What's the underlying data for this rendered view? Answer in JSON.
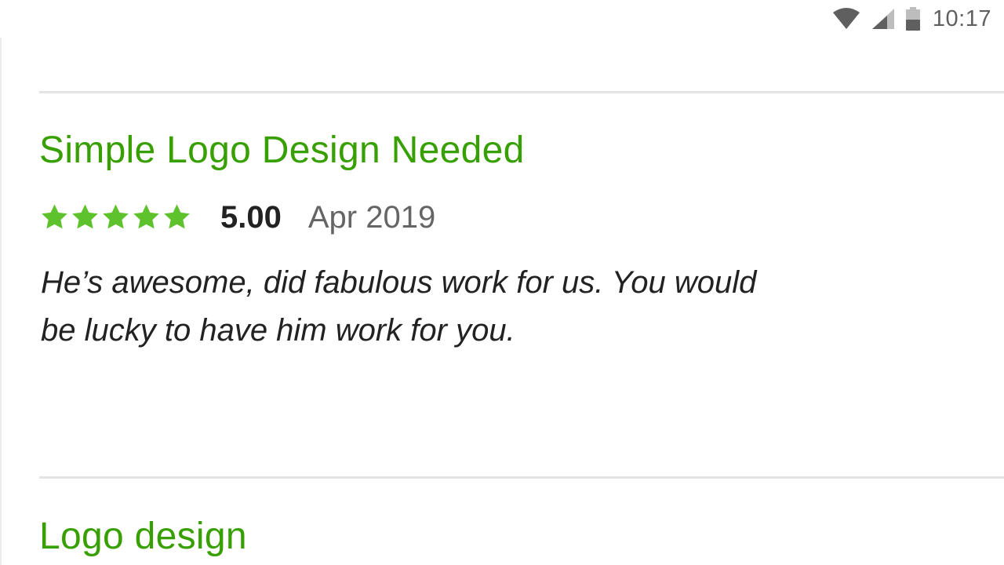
{
  "status_bar": {
    "time": "10:17",
    "icons": [
      "wifi-icon",
      "cellular-signal-icon",
      "battery-icon"
    ],
    "icon_color": "#5f5f5f"
  },
  "colors": {
    "title_green": "#37a000",
    "star_green": "#5ec22c",
    "divider": "#e4e4e4"
  },
  "reviews": [
    {
      "title": "Simple Logo Design Needed",
      "stars": 5,
      "rating": "5.00",
      "date": "Apr 2019",
      "comment": "He’s awesome, did fabulous work for us. You would be lucky to have him work for you."
    },
    {
      "title": "Logo design"
    }
  ]
}
